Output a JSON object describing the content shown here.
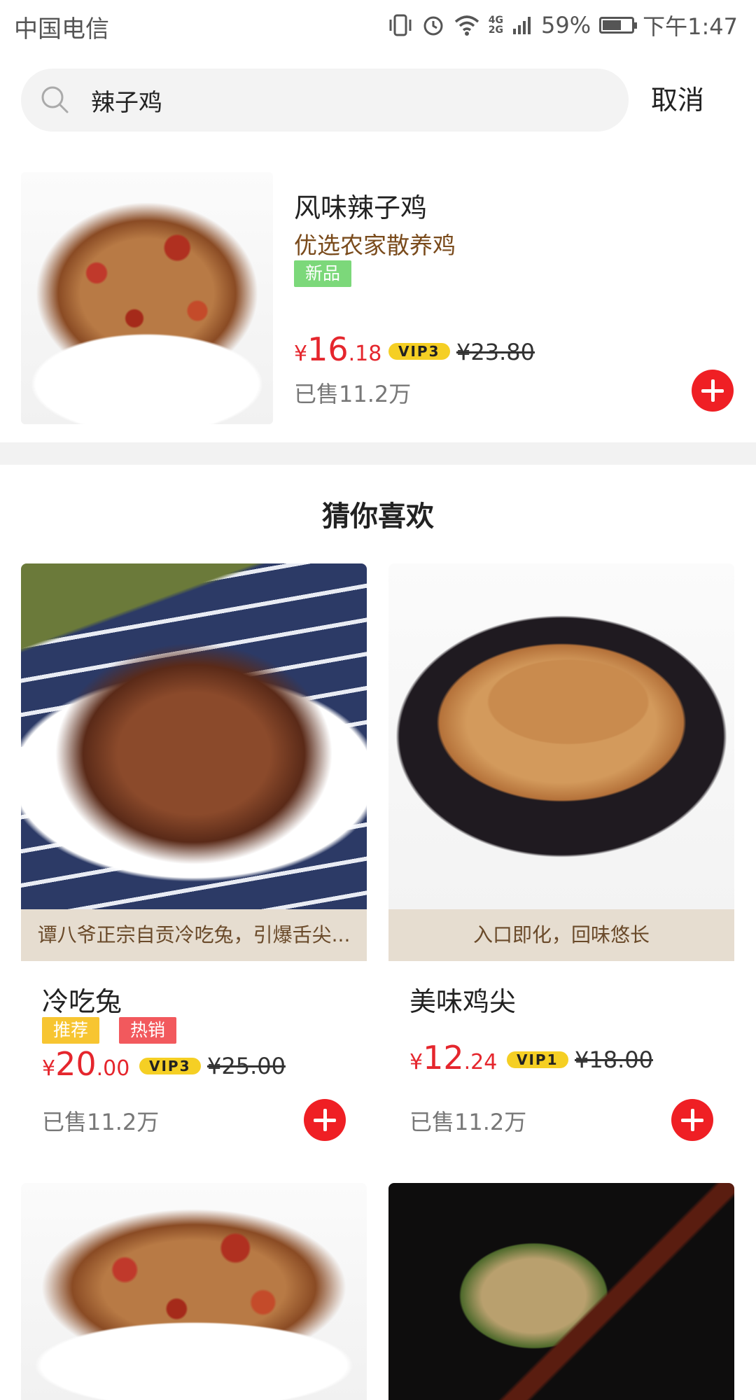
{
  "status_bar": {
    "carrier": "中国电信",
    "battery": "59%",
    "time": "下午1:47",
    "net": [
      "4G",
      "2G"
    ]
  },
  "search": {
    "value": "辣子鸡",
    "cancel_label": "取消"
  },
  "result": {
    "title": "风味辣子鸡",
    "subtitle": "优选农家散养鸡",
    "tag": "新品",
    "price_currency": "¥",
    "price_int": "16",
    "price_dec": ".18",
    "vip": "VIP3",
    "old_price": "¥23.80",
    "sold": "已售11.2万"
  },
  "recommend": {
    "title": "猜你喜欢",
    "items": [
      {
        "banner": "谭八爷正宗自贡冷吃兔，引爆舌尖...",
        "title": "冷吃兔",
        "tags": [
          "推荐",
          "热销"
        ],
        "price_currency": "¥",
        "price_int": "20",
        "price_dec": ".00",
        "vip": "VIP3",
        "old_price": "¥25.00",
        "sold": "已售11.2万"
      },
      {
        "banner": "入口即化，回味悠长",
        "title": "美味鸡尖",
        "tags": [],
        "price_currency": "¥",
        "price_int": "12",
        "price_dec": ".24",
        "vip": "VIP1",
        "old_price": "¥18.00",
        "sold": "已售11.2万"
      }
    ]
  },
  "colors": {
    "price_red": "#e5262d",
    "vip_yellow": "#f5cf24",
    "tag_new": "#7cd87a",
    "tag_recommend": "#f7c531",
    "tag_hot": "#f2595d"
  }
}
